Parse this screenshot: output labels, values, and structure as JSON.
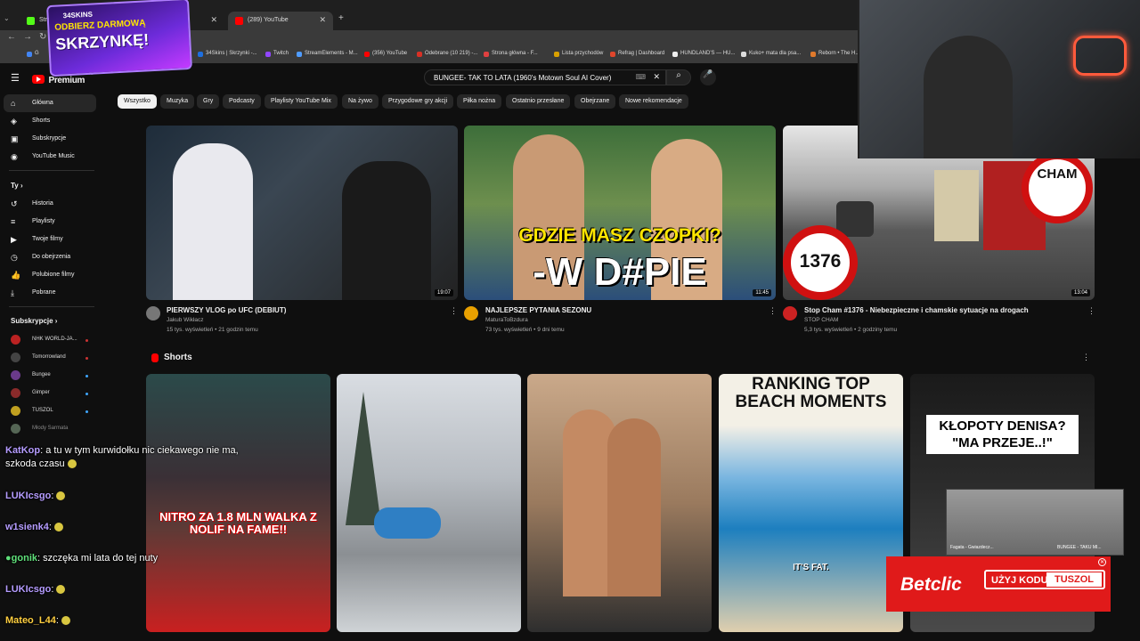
{
  "browser": {
    "tabs": [
      {
        "label": "Stream",
        "color": "#53fc18"
      },
      {
        "label": "(289) YouTube",
        "color": "#ff0000"
      }
    ],
    "bookmarks": [
      {
        "label": "34Skins | Skrzynki -...",
        "color": "#1d6fe0"
      },
      {
        "label": "Twitch",
        "color": "#9146ff"
      },
      {
        "label": "StreamElements - M...",
        "color": "#4f9cff"
      },
      {
        "label": "(356) YouTube",
        "color": "#ff0000"
      },
      {
        "label": "Odebrane (10 219) -...",
        "color": "#d93025"
      },
      {
        "label": "Strona główna - F...",
        "color": "#e04040"
      },
      {
        "label": "Lista przychodów",
        "color": "#d9a000"
      },
      {
        "label": "Refrag | Dashboard",
        "color": "#e0462c"
      },
      {
        "label": "HUNDLAND'S — HU...",
        "color": "#eeeeee"
      },
      {
        "label": "Kuko+ mata dla psa...",
        "color": "#dddddd"
      },
      {
        "label": "Reborn • The H...",
        "color": "#e07a2c"
      }
    ]
  },
  "promo": {
    "brand": "34SKINS",
    "line1": "ODBIERZ DARMOWĄ",
    "line2": "SKRZYNKĘ!"
  },
  "header": {
    "logo": "Premium",
    "region": "PL",
    "search_value": "BUNGEE- TAK TO LATA (1960's Motown Soul AI Cover)"
  },
  "chips": [
    "Wszystko",
    "Muzyka",
    "Gry",
    "Podcasty",
    "Playlisty YouTube Mix",
    "Na żywo",
    "Przygodowe gry akcji",
    "Piłka nożna",
    "Ostatnio przesłane",
    "Obejrzane",
    "Nowe rekomendacje"
  ],
  "sidebar": {
    "main": [
      {
        "label": "Główna",
        "icon": "home-icon"
      },
      {
        "label": "Shorts",
        "icon": "shorts-icon"
      },
      {
        "label": "Subskrypcje",
        "icon": "subscriptions-icon"
      },
      {
        "label": "YouTube Music",
        "icon": "music-icon"
      }
    ],
    "you_title": "Ty",
    "you": [
      {
        "label": "Historia",
        "icon": "history-icon"
      },
      {
        "label": "Playlisty",
        "icon": "playlist-icon"
      },
      {
        "label": "Twoje filmy",
        "icon": "your-videos-icon"
      },
      {
        "label": "Do obejrzenia",
        "icon": "watch-later-icon"
      },
      {
        "label": "Polubione filmy",
        "icon": "liked-icon"
      },
      {
        "label": "Pobrane",
        "icon": "download-icon"
      }
    ],
    "subs_title": "Subskrypcje",
    "subs": [
      {
        "label": "NHK WORLD-JA...",
        "color": "#bb2222"
      },
      {
        "label": "Tomorrowland",
        "color": "#444444"
      },
      {
        "label": "Bungee",
        "color": "#6a3a8a"
      },
      {
        "label": "Gimper",
        "color": "#8a2a2a"
      },
      {
        "label": "TUSZOL",
        "color": "#c0a020"
      },
      {
        "label": "Młody Sarmata",
        "color": "#556655"
      }
    ]
  },
  "videos": [
    {
      "title": "PIERWSZY VLOG po UFC (DEBIUT)",
      "channel": "Jakub Wikłacz",
      "meta": "15 tys. wyświetleń • 21 godzin temu",
      "duration": "19:07"
    },
    {
      "title": "NAJLEPSZE PYTANIA SEZONU",
      "channel": "MaturaToBzdura",
      "meta": "73 tys. wyświetleń • 9 dni temu",
      "duration": "11:45",
      "overlay1": "GDZIE MASZ CZOPKI?",
      "overlay2": "-W D#PIE"
    },
    {
      "title": "Stop Cham #1376 - Niebezpieczne i chamskie sytuacje na drogach",
      "channel": "STOP CHAM",
      "meta": "5,3 tys. wyświetleń • 2 godziny temu",
      "duration": "13:04",
      "overlay1": "CHAM",
      "overlay2": "1376"
    }
  ],
  "shorts": {
    "title": "Shorts",
    "items": [
      {
        "overlay": "NITRO ZA 1.8 MLN WALKA Z NOLIF NA FAME!!"
      },
      {
        "overlay": ""
      },
      {
        "overlay": ""
      },
      {
        "overlay": "RANKING TOP BEACH MOMENTS",
        "sub": "IT'S FAT."
      },
      {
        "overlay": "KŁOPOTY DENISA? \"MA PRZEJE..!\""
      }
    ]
  },
  "chat": [
    {
      "user": "KatKop",
      "text": "a tu w tym kurwidołku nic ciekawego nie ma,"
    },
    {
      "user": "",
      "text": "szkoda czasu"
    },
    {
      "user": "LUKIcsgo",
      "text": ""
    },
    {
      "user": "w1sienk4",
      "text": ""
    },
    {
      "user": "gonik",
      "text": "szczęka mi lata do tej nuty"
    },
    {
      "user": "LUKIcsgo",
      "text": ""
    },
    {
      "user": "Mateo_L44",
      "text": ""
    }
  ],
  "betclic": {
    "brand": "Betclic",
    "cta": "UŻYJ KODU",
    "code": "TUSZOL"
  },
  "miniplayer": {
    "left": "Fagata - Gwiazdecz...",
    "right": "BUNGEE - TAKU MI..."
  }
}
